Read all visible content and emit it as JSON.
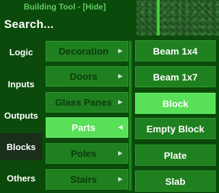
{
  "window": {
    "title": "Building Tool - [Hide]",
    "search_label": "Search..."
  },
  "categories": [
    {
      "label": "Logic"
    },
    {
      "label": "Inputs"
    },
    {
      "label": "Outputs"
    },
    {
      "label": "Blocks",
      "selected": true
    },
    {
      "label": "Others"
    }
  ],
  "subcategories": [
    {
      "label": "Decoration",
      "arrow": "►"
    },
    {
      "label": "Doors",
      "arrow": "►"
    },
    {
      "label": "Glass Panes",
      "arrow": "►"
    },
    {
      "label": "Parts",
      "arrow": "◄",
      "selected": true
    },
    {
      "label": "Poles",
      "arrow": "►"
    },
    {
      "label": "Stairs",
      "arrow": "►"
    }
  ],
  "items": [
    {
      "label": "Beam 1x4"
    },
    {
      "label": "Beam 1x7"
    },
    {
      "label": "Block",
      "selected": true
    },
    {
      "label": "Empty Block"
    },
    {
      "label": "Plate"
    },
    {
      "label": "Slab"
    }
  ],
  "colors": {
    "background": "#0b4a0b",
    "button": "#1f801f",
    "button_selected": "#58e058",
    "category_selected": "#1a2e1a"
  }
}
